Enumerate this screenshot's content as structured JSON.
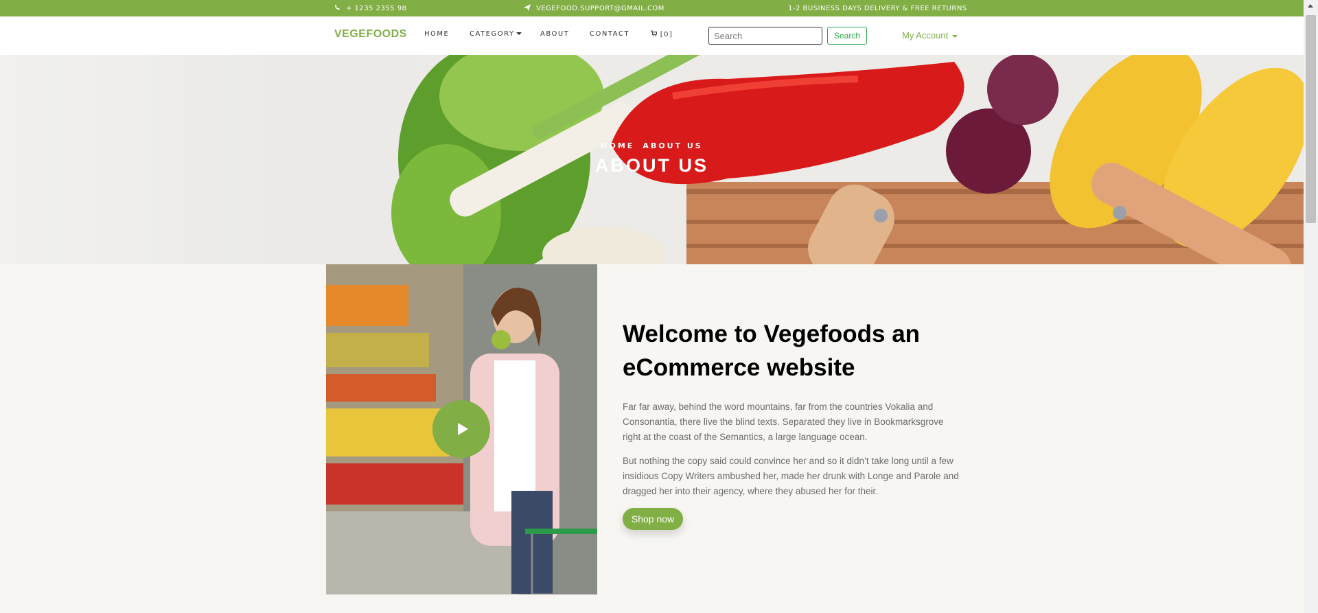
{
  "topbar": {
    "phone": "+ 1235 2355 98",
    "email": "VEGEFOOD.SUPPORT@GMAIL.COM",
    "delivery": "1-2 BUSINESS DAYS DELIVERY & FREE RETURNS"
  },
  "nav": {
    "brand": "VEGEFOODS",
    "home": "HOME",
    "category": "CATEGORY",
    "about": "ABOUT",
    "contact": "CONTACT",
    "cart_count": "[0]",
    "search_placeholder": "Search",
    "search_button": "Search",
    "account": "My Account"
  },
  "hero": {
    "breadcrumb_home": "HOME",
    "breadcrumb_current": "ABOUT US",
    "title": "ABOUT US"
  },
  "about": {
    "heading": "Welcome to Vegefoods an eCommerce website",
    "paragraph1": "Far far away, behind the word mountains, far from the countries Vokalia and Consonantia, there live the blind texts. Separated they live in Bookmarksgrove right at the coast of the Semantics, a large language ocean.",
    "paragraph2": "But nothing the copy said could convince her and so it didn’t take long until a few insidious Copy Writers ambushed her, made her drunk with Longe and Parole and dragged her into their agency, where they abused her for their.",
    "shop_button": "Shop now"
  },
  "colors": {
    "accent": "#82ae46",
    "background": "#f7f6f2",
    "search_green": "#28a745"
  },
  "icons": [
    "phone-icon",
    "paper-plane-icon",
    "cart-icon",
    "play-icon"
  ]
}
